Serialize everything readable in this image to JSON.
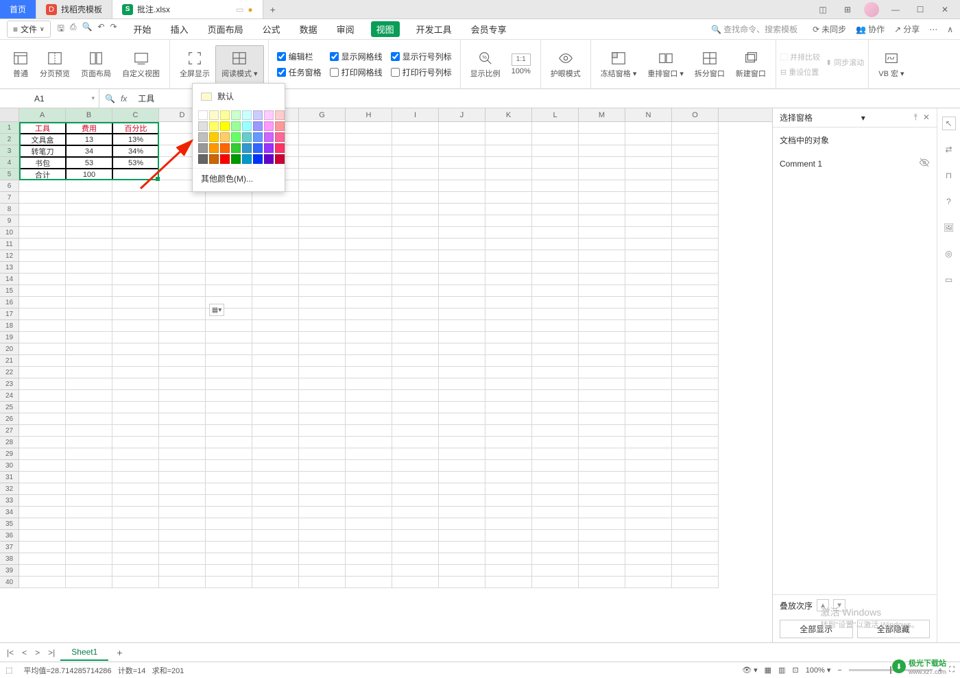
{
  "tabs": {
    "home": "首页",
    "template": "找稻壳模板",
    "doc": "批注.xlsx"
  },
  "file_menu": "文件",
  "menus": {
    "start": "开始",
    "insert": "插入",
    "page_layout": "页面布局",
    "formula": "公式",
    "data": "数据",
    "review": "审阅",
    "view": "视图",
    "dev_tools": "开发工具",
    "member": "会员专享"
  },
  "menu_right": {
    "search_placeholder": "查找命令、搜索模板",
    "unsync": "未同步",
    "collab": "协作",
    "share": "分享"
  },
  "ribbon": {
    "normal": "普通",
    "page_break": "分页预览",
    "page_layout": "页面布局",
    "custom_view": "自定义视图",
    "full_screen": "全屏显示",
    "reading_mode": "阅读模式",
    "edit_bar": "编辑栏",
    "task_pane": "任务窗格",
    "show_grid": "显示网格线",
    "print_grid": "打印网格线",
    "show_headings": "显示行号列标",
    "print_headings": "打印行号列标",
    "zoom": "显示比例",
    "zoom_100": "100%",
    "eye_protect": "护眼模式",
    "freeze": "冻结窗格",
    "arrange": "重排窗口",
    "split": "拆分窗口",
    "new_window": "新建窗口",
    "side_by_side": "并排比较",
    "reset_pos": "重设位置",
    "sync_scroll": "同步滚动",
    "vb_macro": "VB 宏"
  },
  "name_box": "A1",
  "fx_value": "工具",
  "columns": [
    "A",
    "B",
    "C",
    "D",
    "E",
    "F",
    "G",
    "H",
    "I",
    "J",
    "K",
    "L",
    "M",
    "N",
    "O"
  ],
  "row_count": 40,
  "table": {
    "header": [
      "工具",
      "费用",
      "百分比"
    ],
    "rows": [
      [
        "文具盒",
        "13",
        "13%"
      ],
      [
        "转笔刀",
        "34",
        "34%"
      ],
      [
        "书包",
        "53",
        "53%"
      ],
      [
        "合计",
        "100",
        ""
      ]
    ]
  },
  "color_picker": {
    "default": "默认",
    "more": "其他颜色(M)...",
    "colors": [
      "#ffffff",
      "#fffacd",
      "#ffff99",
      "#ccffcc",
      "#ccffff",
      "#ccccff",
      "#ffccff",
      "#ffcccc",
      "#e0e0e0",
      "#ffff66",
      "#ffff00",
      "#99ff99",
      "#99ffff",
      "#9999ff",
      "#ff99ff",
      "#ff9999",
      "#bfbfbf",
      "#ffcc00",
      "#ffcc66",
      "#66ff66",
      "#66cccc",
      "#6699ff",
      "#cc66ff",
      "#ff6699",
      "#999999",
      "#ff9900",
      "#ff6600",
      "#33cc33",
      "#3399cc",
      "#3366ff",
      "#9933ff",
      "#ff3366",
      "#666666",
      "#cc6600",
      "#ff0000",
      "#009900",
      "#0099cc",
      "#0033ff",
      "#6600cc",
      "#cc0033"
    ]
  },
  "right_panel": {
    "title": "选择窗格",
    "section": "文档中的对象",
    "items": [
      "Comment 1"
    ],
    "stack": "叠放次序",
    "show_all": "全部显示",
    "hide_all": "全部隐藏"
  },
  "sheet_tab": "Sheet1",
  "status": {
    "avg_label": "平均值=",
    "avg": "28.714285714286",
    "count_label": "计数=",
    "count": "14",
    "sum_label": "求和=",
    "sum": "201",
    "zoom": "100%"
  },
  "watermark": {
    "line1": "激活 Windows",
    "line2": "转到\"设置\"以激活 Windows。"
  },
  "logo": {
    "text": "极光下载站",
    "url": "www.xz7.com"
  }
}
